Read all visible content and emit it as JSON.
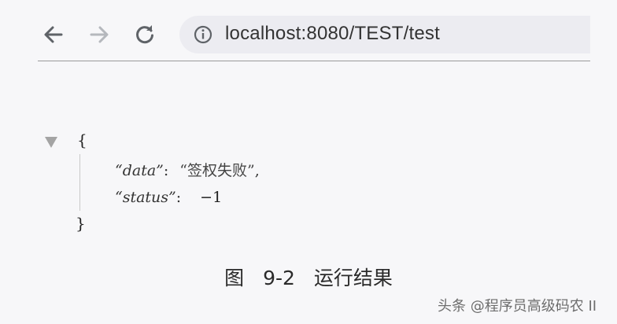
{
  "browser": {
    "url": "localhost:8080/TEST/test",
    "icons": {
      "back": "arrow-left-icon",
      "forward": "arrow-right-icon",
      "reload": "reload-icon",
      "info": "info-icon"
    },
    "colors": {
      "address_bar": "#ececf1",
      "icon_active": "#5f6368",
      "icon_disabled": "#b5b8bd"
    }
  },
  "json_view": {
    "open_brace": "{",
    "close_brace": "}",
    "rows": [
      {
        "key": "“data”",
        "sep": ":",
        "value": "“签权失败”",
        "trail": ","
      },
      {
        "key": "“status”",
        "sep": ":",
        "value": "−1",
        "trail": ""
      }
    ]
  },
  "caption": "图 9-2 运行结果",
  "watermark": "头条 @程序员高级码农 II"
}
